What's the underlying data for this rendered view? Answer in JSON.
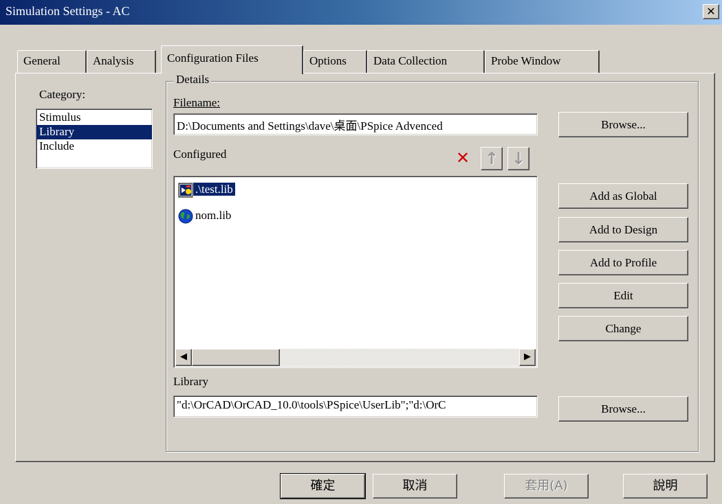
{
  "window": {
    "title": "Simulation Settings - AC",
    "close_label": "✕"
  },
  "tabs": [
    {
      "label": "General",
      "active": false
    },
    {
      "label": "Analysis",
      "active": false
    },
    {
      "label": "Configuration Files",
      "active": true
    },
    {
      "label": "Options",
      "active": false
    },
    {
      "label": "Data Collection",
      "active": false
    },
    {
      "label": "Probe Window",
      "active": false
    }
  ],
  "category": {
    "label": "Category:",
    "items": [
      "Stimulus",
      "Library",
      "Include"
    ],
    "selected": "Library"
  },
  "details": {
    "group_label": "Details",
    "filename_label": "Filename:",
    "filename_value": "D:\\Documents and Settings\\dave\\桌面\\PSpice Advenced",
    "browse_label": "Browse...",
    "configured_label": "Configured",
    "configured_items": [
      {
        "name": ".\\test.lib",
        "icon": "local-library-icon",
        "selected": true
      },
      {
        "name": "nom.lib",
        "icon": "global-library-icon",
        "selected": false
      }
    ],
    "toolbar": {
      "delete_icon": "delete-x-icon",
      "up_icon": "move-up-arrow-icon",
      "down_icon": "move-down-arrow-icon"
    },
    "library_label": "Library",
    "library_value": "\"d:\\OrCAD\\OrCAD_10.0\\tools\\PSpice\\UserLib\";\"d:\\OrC",
    "library_browse_label": "Browse..."
  },
  "side_buttons": [
    "Add as Global",
    "Add to Design",
    "Add to Profile",
    "Edit",
    "Change"
  ],
  "footer": {
    "ok_label": "確定",
    "cancel_label": "取消",
    "apply_label": "套用(A)",
    "help_label": "說明"
  }
}
